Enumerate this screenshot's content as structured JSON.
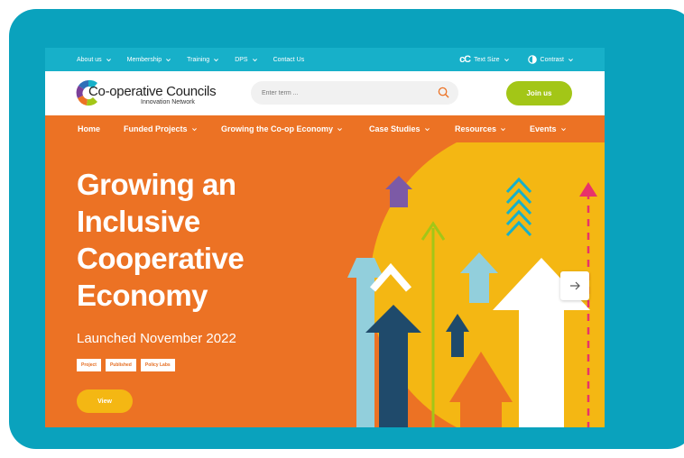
{
  "utility_bar": {
    "items": [
      {
        "label": "About us",
        "has_dropdown": true
      },
      {
        "label": "Membership",
        "has_dropdown": true
      },
      {
        "label": "Training",
        "has_dropdown": true
      },
      {
        "label": "DPS",
        "has_dropdown": true
      },
      {
        "label": "Contact Us",
        "has_dropdown": false
      }
    ],
    "text_size_glyph": "cC",
    "text_size_label": "Text Size",
    "contrast_label": "Contrast"
  },
  "header": {
    "logo_name": "Co-operative Councils",
    "logo_sub": "Innovation Network",
    "search_placeholder": "Enter term ...",
    "join_label": "Join us"
  },
  "main_nav": {
    "items": [
      {
        "label": "Home",
        "has_dropdown": false
      },
      {
        "label": "Funded Projects",
        "has_dropdown": true
      },
      {
        "label": "Growing the Co-op Economy",
        "has_dropdown": true
      },
      {
        "label": "Case Studies",
        "has_dropdown": true
      },
      {
        "label": "Resources",
        "has_dropdown": true
      },
      {
        "label": "Events",
        "has_dropdown": true
      }
    ]
  },
  "hero": {
    "title": "Growing an Inclusive Cooperative Economy",
    "subtitle": "Launched November 2022",
    "tags": [
      "Project",
      "Published",
      "Policy Labs"
    ],
    "view_label": "View"
  },
  "colors": {
    "frame_teal": "#0aa2bd",
    "utility_bar": "#17b0c9",
    "brand_orange": "#ec7224",
    "join_green": "#a3c617",
    "view_yellow": "#f4b713"
  },
  "icons": {
    "search": "search-icon",
    "contrast": "contrast-icon",
    "next": "arrow-right-icon",
    "dropdown": "chevron-down-icon"
  }
}
